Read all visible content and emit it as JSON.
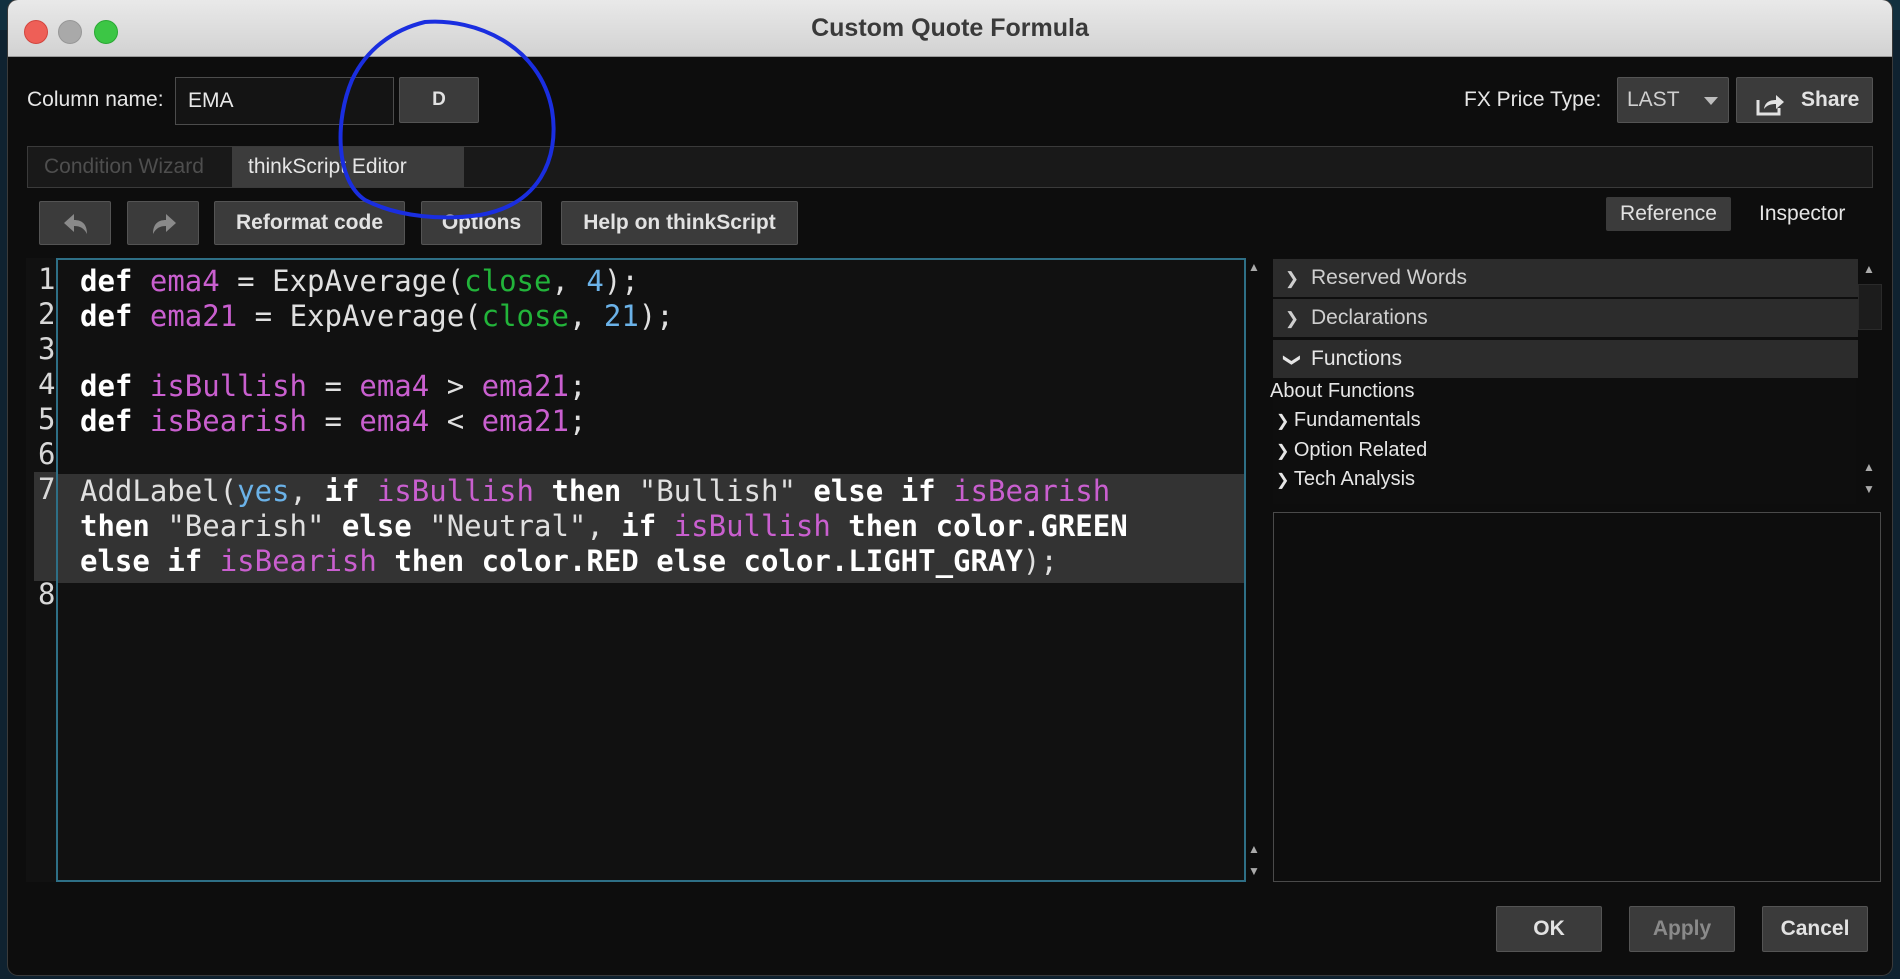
{
  "window": {
    "title": "Custom Quote Formula"
  },
  "header": {
    "column_name_label": "Column name:",
    "column_name_value": "EMA",
    "aggregation_button": "D",
    "fx_label": "FX Price Type:",
    "fx_value": "LAST",
    "share_label": "Share"
  },
  "tabs": [
    {
      "label": "Condition Wizard",
      "active": false
    },
    {
      "label": "thinkScript Editor",
      "active": true
    }
  ],
  "toolbar": {
    "undo_icon": "undo-arrow-icon",
    "redo_icon": "redo-arrow-icon",
    "reformat_label": "Reformat code",
    "options_label": "Options",
    "help_label": "Help on thinkScript",
    "reference_label": "Reference",
    "inspector_label": "Inspector"
  },
  "editor": {
    "line_numbers": [
      "1",
      "2",
      "3",
      "4",
      "5",
      "6",
      "7",
      "8"
    ],
    "highlighted_line": 7,
    "lines": [
      [
        [
          "kw",
          "def"
        ],
        [
          "pn",
          " "
        ],
        [
          "vr",
          "ema4"
        ],
        [
          "pn",
          " = "
        ],
        [
          "fn",
          "ExpAverage("
        ],
        [
          "gr",
          "close"
        ],
        [
          "pn",
          ", "
        ],
        [
          "nm",
          "4"
        ],
        [
          "pn",
          ");"
        ]
      ],
      [
        [
          "kw",
          "def"
        ],
        [
          "pn",
          " "
        ],
        [
          "vr",
          "ema21"
        ],
        [
          "pn",
          " = "
        ],
        [
          "fn",
          "ExpAverage("
        ],
        [
          "gr",
          "close"
        ],
        [
          "pn",
          ", "
        ],
        [
          "nm",
          "21"
        ],
        [
          "pn",
          ");"
        ]
      ],
      [],
      [
        [
          "kw",
          "def"
        ],
        [
          "pn",
          " "
        ],
        [
          "vr",
          "isBullish"
        ],
        [
          "pn",
          " = "
        ],
        [
          "vr",
          "ema4"
        ],
        [
          "pn",
          " > "
        ],
        [
          "vr",
          "ema21"
        ],
        [
          "pn",
          ";"
        ]
      ],
      [
        [
          "kw",
          "def"
        ],
        [
          "pn",
          " "
        ],
        [
          "vr",
          "isBearish"
        ],
        [
          "pn",
          " = "
        ],
        [
          "vr",
          "ema4"
        ],
        [
          "pn",
          " < "
        ],
        [
          "vr",
          "ema21"
        ],
        [
          "pn",
          ";"
        ]
      ],
      [],
      [
        [
          "fn",
          "AddLabel("
        ],
        [
          "nm",
          "yes"
        ],
        [
          "pn",
          ", "
        ],
        [
          "kw",
          "if"
        ],
        [
          "pn",
          " "
        ],
        [
          "vr",
          "isBullish"
        ],
        [
          "pn",
          " "
        ],
        [
          "kw",
          "then"
        ],
        [
          "pn",
          " "
        ],
        [
          "st",
          "\"Bullish\""
        ],
        [
          "pn",
          " "
        ],
        [
          "kw",
          "else"
        ],
        [
          "pn",
          " "
        ],
        [
          "kw",
          "if"
        ],
        [
          "pn",
          " "
        ],
        [
          "vr",
          "isBearish"
        ]
      ],
      [
        [
          "kw",
          "then"
        ],
        [
          "pn",
          " "
        ],
        [
          "st",
          "\"Bearish\""
        ],
        [
          "pn",
          " "
        ],
        [
          "kw",
          "else"
        ],
        [
          "pn",
          " "
        ],
        [
          "st",
          "\"Neutral\""
        ],
        [
          "pn",
          ", "
        ],
        [
          "kw",
          "if"
        ],
        [
          "pn",
          " "
        ],
        [
          "vr",
          "isBullish"
        ],
        [
          "pn",
          " "
        ],
        [
          "kw",
          "then"
        ],
        [
          "pn",
          " "
        ],
        [
          "kw",
          "color.GREEN"
        ]
      ],
      [
        [
          "kw",
          "else"
        ],
        [
          "pn",
          " "
        ],
        [
          "kw",
          "if"
        ],
        [
          "pn",
          " "
        ],
        [
          "vr",
          "isBearish"
        ],
        [
          "pn",
          " "
        ],
        [
          "kw",
          "then"
        ],
        [
          "pn",
          " "
        ],
        [
          "kw",
          "color.RED"
        ],
        [
          "pn",
          " "
        ],
        [
          "kw",
          "else"
        ],
        [
          "pn",
          " "
        ],
        [
          "kw",
          "color.LIGHT_GRAY"
        ],
        [
          "pn",
          ");"
        ]
      ],
      []
    ]
  },
  "reference": {
    "sections": [
      {
        "label": "Reserved Words",
        "expanded": false
      },
      {
        "label": "Declarations",
        "expanded": false
      },
      {
        "label": "Functions",
        "expanded": true
      }
    ],
    "tree": [
      {
        "label": "About Functions",
        "arrow": false
      },
      {
        "label": "Fundamentals",
        "arrow": true
      },
      {
        "label": "Option Related",
        "arrow": true
      },
      {
        "label": "Tech Analysis",
        "arrow": true
      }
    ]
  },
  "footer": {
    "ok_label": "OK",
    "apply_label": "Apply",
    "cancel_label": "Cancel"
  },
  "colors": {
    "annotation": "#1a2ee0",
    "editor_border": "#2e6f86",
    "keyword": "#ffffff",
    "variable": "#c95fcf",
    "constant_green": "#22b43a",
    "number_blue": "#6bb2e8"
  }
}
